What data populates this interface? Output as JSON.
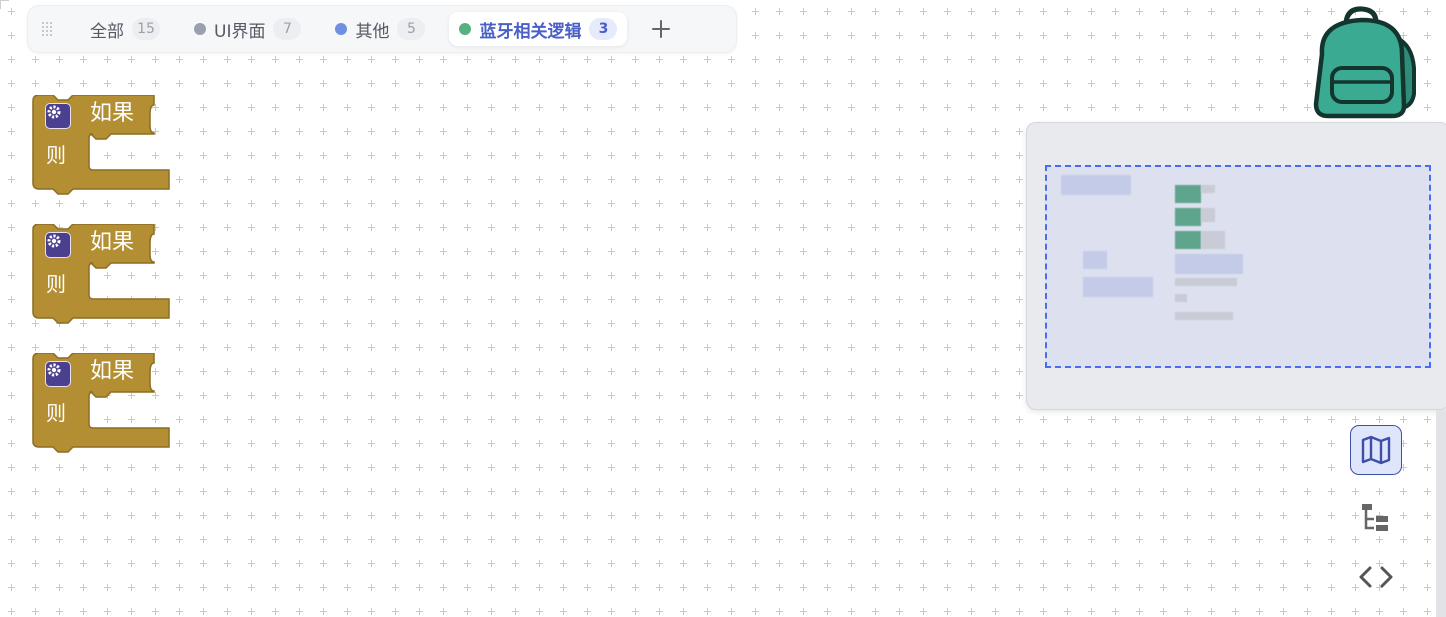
{
  "tabs": [
    {
      "label": "全部",
      "count": "15",
      "dot": null
    },
    {
      "label": "UI界面",
      "count": "7",
      "dot": "#9aa0ad"
    },
    {
      "label": "其他",
      "count": "5",
      "dot": "#6f8fe0"
    },
    {
      "label": "蓝牙相关逻辑",
      "count": "3",
      "dot": "#57b081",
      "active": true
    }
  ],
  "add_tab_icon": "plus-icon",
  "blocks": [
    {
      "if_label": "如果",
      "then_label": "则"
    },
    {
      "if_label": "如果",
      "then_label": "则"
    },
    {
      "if_label": "如果",
      "then_label": "则"
    }
  ],
  "colors": {
    "block_fill": "#b38e33",
    "block_stroke": "#8c6d22",
    "gear_bg": "#4b3f8f",
    "accent": "#4a5fc8",
    "backpack": "#3aaa93",
    "viewport_border": "#4a6cf4"
  },
  "toolbar": {
    "minimap_icon": "map-icon",
    "tree_icon": "tree-structure-icon",
    "code_icon": "code-icon"
  }
}
